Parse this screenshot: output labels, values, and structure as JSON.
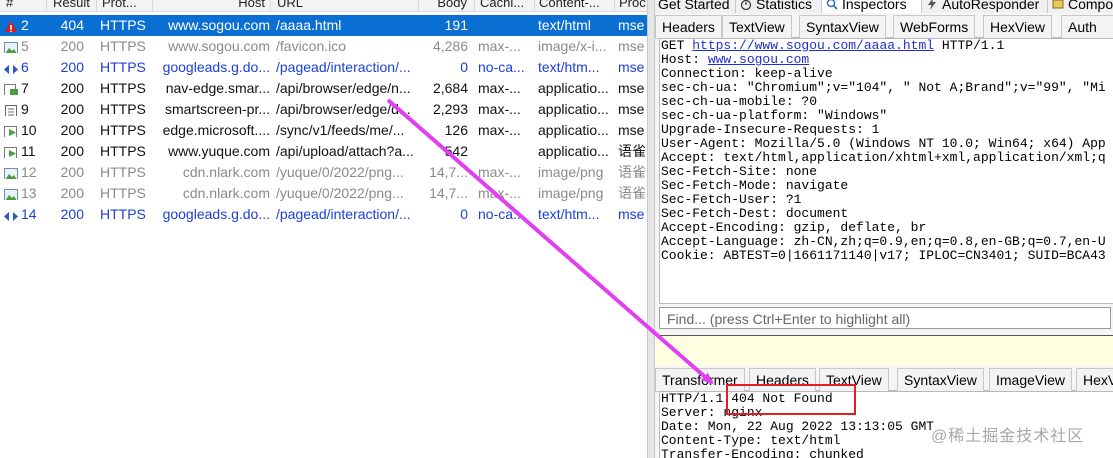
{
  "session_list": {
    "columns": [
      "#",
      "Result",
      "Prot...",
      "Host",
      "URL",
      "Body",
      "Cachi...",
      "Content-...",
      "Proc"
    ],
    "rows": [
      {
        "num": "2",
        "result": "404",
        "protocol": "HTTPS",
        "host": "www.sogou.com",
        "url": "/aaaa.html",
        "body": "191",
        "caching": "",
        "content_type": "text/html",
        "process": "mse",
        "style": "sel",
        "icon": "warning-icon"
      },
      {
        "num": "5",
        "result": "200",
        "protocol": "HTTPS",
        "host": "www.sogou.com",
        "url": "/favicon.ico",
        "body": "4,286",
        "caching": "max-...",
        "content_type": "image/x-i...",
        "process": "mse",
        "style": "gray",
        "icon": "image-icon"
      },
      {
        "num": "6",
        "result": "200",
        "protocol": "HTTPS",
        "host": "googleads.g.do...",
        "url": "/pagead/interaction/...",
        "body": "0",
        "caching": "no-ca...",
        "content_type": "text/htm...",
        "process": "mse",
        "style": "blue",
        "icon": "arrows-icon"
      },
      {
        "num": "7",
        "result": "200",
        "protocol": "HTTPS",
        "host": "nav-edge.smar...",
        "url": "/api/browser/edge/n...",
        "body": "2,684",
        "caching": "max-...",
        "content_type": "applicatio...",
        "process": "mse",
        "style": "black",
        "icon": "script-icon"
      },
      {
        "num": "9",
        "result": "200",
        "protocol": "HTTPS",
        "host": "smartscreen-pr...",
        "url": "/api/browser/edge/d...",
        "body": "2,293",
        "caching": "max-...",
        "content_type": "applicatio...",
        "process": "mse",
        "style": "black",
        "icon": "document-icon"
      },
      {
        "num": "10",
        "result": "200",
        "protocol": "HTTPS",
        "host": "edge.microsoft....",
        "url": "/sync/v1/feeds/me/...",
        "body": "126",
        "caching": "max-...",
        "content_type": "applicatio...",
        "process": "mse",
        "style": "black",
        "icon": "json-icon"
      },
      {
        "num": "11",
        "result": "200",
        "protocol": "HTTPS",
        "host": "www.yuque.com",
        "url": "/api/upload/attach?a...",
        "body": "542",
        "caching": "",
        "content_type": "applicatio...",
        "process": "语雀",
        "style": "black",
        "icon": "json-icon"
      },
      {
        "num": "12",
        "result": "200",
        "protocol": "HTTPS",
        "host": "cdn.nlark.com",
        "url": "/yuque/0/2022/png...",
        "body": "14,7...",
        "caching": "max-...",
        "content_type": "image/png",
        "process": "语雀",
        "style": "gray",
        "icon": "image-icon"
      },
      {
        "num": "13",
        "result": "200",
        "protocol": "HTTPS",
        "host": "cdn.nlark.com",
        "url": "/yuque/0/2022/png...",
        "body": "14,7...",
        "caching": "max-...",
        "content_type": "image/png",
        "process": "语雀",
        "style": "gray",
        "icon": "image-icon"
      },
      {
        "num": "14",
        "result": "200",
        "protocol": "HTTPS",
        "host": "googleads.g.do...",
        "url": "/pagead/interaction/...",
        "body": "0",
        "caching": "no-ca...",
        "content_type": "text/htm...",
        "process": "mse",
        "style": "blue",
        "icon": "arrows-icon"
      }
    ]
  },
  "top_tabs": {
    "get_started": "Get Started",
    "statistics": "Statistics",
    "inspectors": "Inspectors",
    "autoresponder": "AutoResponder",
    "composer": "Compo"
  },
  "request_tabs": [
    "Headers",
    "TextView",
    "SyntaxView",
    "WebForms",
    "HexView",
    "Auth"
  ],
  "request_raw": {
    "line1_prefix": "GET ",
    "line1_link": "https://www.sogou.com/aaaa.html",
    "line1_suffix": " HTTP/1.1",
    "line2_prefix": "Host: ",
    "line2_link": "www.sogou.com",
    "lines": [
      "Connection: keep-alive",
      "sec-ch-ua: \"Chromium\";v=\"104\", \" Not A;Brand\";v=\"99\", \"Mi",
      "sec-ch-ua-mobile: ?0",
      "sec-ch-ua-platform: \"Windows\"",
      "Upgrade-Insecure-Requests: 1",
      "User-Agent: Mozilla/5.0 (Windows NT 10.0; Win64; x64) App",
      "Accept: text/html,application/xhtml+xml,application/xml;q",
      "Sec-Fetch-Site: none",
      "Sec-Fetch-Mode: navigate",
      "Sec-Fetch-User: ?1",
      "Sec-Fetch-Dest: document",
      "Accept-Encoding: gzip, deflate, br",
      "Accept-Language: zh-CN,zh;q=0.9,en;q=0.8,en-GB;q=0.7,en-U",
      "Cookie: ABTEST=0|1661171140|v17; IPLOC=CN3401; SUID=BCA43"
    ]
  },
  "find_placeholder": "Find... (press Ctrl+Enter to highlight all)",
  "response_tabs": [
    "Transformer",
    "Headers",
    "TextView",
    "SyntaxView",
    "ImageView",
    "HexVi"
  ],
  "response_raw": {
    "lines": [
      "HTTP/1.1 404 Not Found",
      "Server: nginx",
      "Date: Mon, 22 Aug 2022 13:13:05 GMT",
      "Content-Type: text/html",
      "Transfer-Encoding: chunked"
    ]
  },
  "watermark": "@稀土掘金技术社区",
  "colors": {
    "selected_row": "#0a6fd3",
    "arrow": "#e040f0",
    "highlight_box": "#e02020",
    "link": "#1f2fd1"
  }
}
